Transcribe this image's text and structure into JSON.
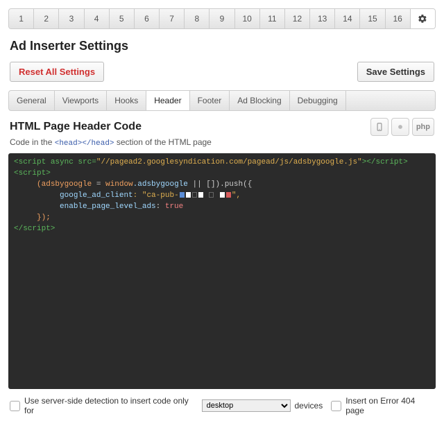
{
  "blockTabs": [
    "1",
    "2",
    "3",
    "4",
    "5",
    "6",
    "7",
    "8",
    "9",
    "10",
    "11",
    "12",
    "13",
    "14",
    "15",
    "16"
  ],
  "title": "Ad Inserter Settings",
  "actions": {
    "reset": "Reset All Settings",
    "save": "Save Settings"
  },
  "settingsTabs": [
    "General",
    "Viewports",
    "Hooks",
    "Header",
    "Footer",
    "Ad Blocking",
    "Debugging"
  ],
  "activeSettingsTab": "Header",
  "section": {
    "title": "HTML Page Header Code",
    "subPrefix": "Code in the ",
    "subTag": "<head></head>",
    "subSuffix": " section of the HTML page",
    "phpLabel": "php"
  },
  "code": {
    "scriptOpen": "<script",
    "asyncAttr": " async src=",
    "src": "\"//pagead2.googlesyndication.com/pagead/js/adsbygoogle.js\"",
    "scriptClose": "></script>",
    "script2Open": "<script>",
    "indent": "     ",
    "line2a": "(adsbygoogle ",
    "line2b": "= ",
    "line2c": "window",
    "line2d": ".adsbygoogle ",
    "line2e": "|| []).push({",
    "line3k": "google_ad_client",
    "line3v1": ": \"ca-pub-",
    "line3v2": "\",",
    "line4k": "enable_page_level_ads",
    "line4v": ": ",
    "line4t": "true",
    "line5": "});",
    "script2Close": "</script>"
  },
  "footer": {
    "serverSide": "Use server-side detection to insert code only for",
    "devicesSuffix": "devices",
    "deviceOptions": [
      "desktop"
    ],
    "error404": "Insert on Error 404 page"
  }
}
